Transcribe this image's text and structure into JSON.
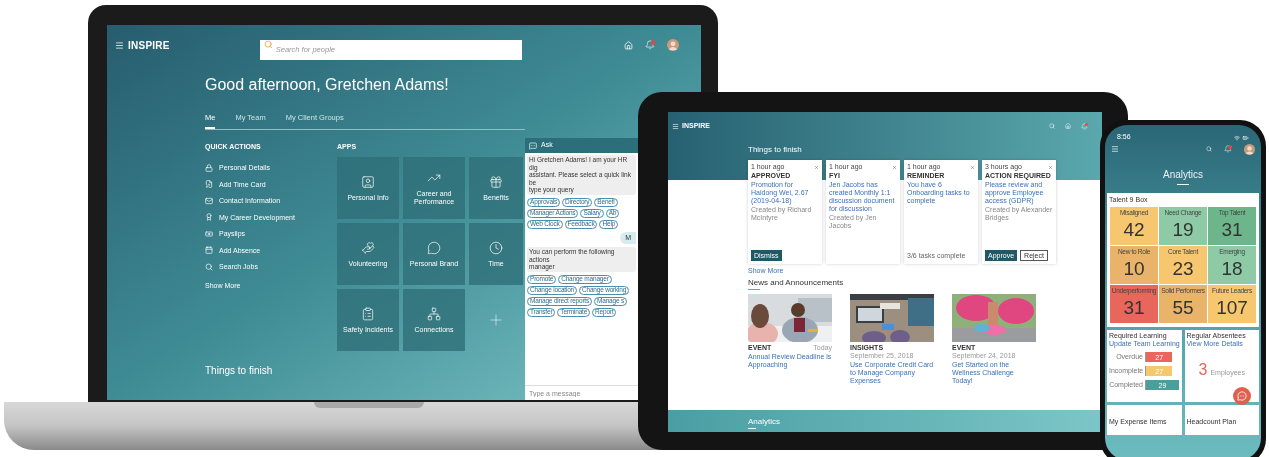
{
  "laptop": {
    "app_name": "INSPIRE",
    "search": {
      "placeholder": "Search for people"
    },
    "greeting": "Good afternoon, Gretchen Adams!",
    "tabs": [
      {
        "label": "Me",
        "selected": true
      },
      {
        "label": "My Team",
        "selected": false
      },
      {
        "label": "My Client Groups",
        "selected": false
      }
    ],
    "quick_actions": {
      "heading": "QUICK ACTIONS",
      "items": [
        "Personal Details",
        "Add Time Card",
        "Contact Information",
        "My Career Development",
        "Payslips",
        "Add Absence",
        "Search Jobs"
      ],
      "show_more": "Show More"
    },
    "apps": {
      "heading": "APPS",
      "tiles": [
        {
          "kind": "app",
          "label": "Personal Info"
        },
        {
          "kind": "app",
          "label": "Career and Performance"
        },
        {
          "kind": "app",
          "label": "Benefits"
        },
        {
          "kind": "app",
          "label": "Volunteering"
        },
        {
          "kind": "app",
          "label": "Personal Brand"
        },
        {
          "kind": "app",
          "label": "Time"
        },
        {
          "kind": "app",
          "label": "Safety Incidents"
        },
        {
          "kind": "app",
          "label": "Connections"
        },
        {
          "kind": "add"
        }
      ]
    },
    "section_title": "Things to finish",
    "chat": {
      "title": "Ask",
      "messages": [
        {
          "kind": "bot",
          "lines": [
            "Hi Gretchen Adams! I am your HR dig",
            "assistant. Please select a quick link be",
            "type your query"
          ]
        },
        {
          "kind": "chips",
          "rows": [
            [
              "Approvals",
              "Directory",
              "Benefi"
            ],
            [
              "Manager Actions",
              "Salary",
              "Ab"
            ],
            [
              "Web Clock",
              "Feedback",
              "Help"
            ]
          ]
        },
        {
          "kind": "user",
          "text": "M"
        },
        {
          "kind": "bot",
          "lines": [
            "You can perform the following actions",
            "manager"
          ]
        },
        {
          "kind": "chips",
          "rows": [
            [
              "Promote",
              "Change manager"
            ],
            [
              "Change location",
              "Change working"
            ],
            [
              "Manage direct reports",
              "Manage s"
            ],
            [
              "Transfer",
              "Terminate",
              "Report"
            ]
          ]
        }
      ],
      "input": {
        "placeholder": "Type a message"
      }
    }
  },
  "tablet": {
    "app_name": "INSPIRE",
    "section_title": "Things to finish",
    "cards": [
      {
        "time": "1 hour ago",
        "tag": "APPROVED",
        "title": "Promotion for Haidong Wei, 2.67 (2019-04-18)",
        "creator": "Created by Richard McIntyre",
        "buttons": [
          {
            "label": "Dismiss",
            "kind": "primary"
          }
        ]
      },
      {
        "time": "1 hour ago",
        "tag": "FYI",
        "title": "Jen Jacobs has created Monthly 1:1 discussion document for discussion",
        "creator": "Created by Jen Jacobs"
      },
      {
        "time": "1 hour ago",
        "tag": "REMINDER",
        "title": "You have 6 Onboarding tasks to complete",
        "progress": "3/6 tasks complete"
      },
      {
        "time": "3 hours ago",
        "tag": "ACTION REQUIRED",
        "title": "Please review and approve Employee access (GDPR)",
        "creator": "Created by Alexander Bridges",
        "buttons": [
          {
            "label": "Approve",
            "kind": "primary"
          },
          {
            "label": "Reject",
            "kind": "secondary"
          }
        ]
      }
    ],
    "show_more": "Show More",
    "news_title": "News and Announcements",
    "news": [
      {
        "tag": "EVENT",
        "date": "Today",
        "title": "Annual Review Deadline is Approaching",
        "kind": "picture"
      },
      {
        "tag": "INSIGHTS",
        "date": "September 25, 2018",
        "title": "Use Corporate Credit Card to Manage Company Expenses",
        "kind": "picture"
      },
      {
        "tag": "EVENT",
        "date": "September 24, 2018",
        "title": "Get Started on the Wellness Challenge Today!",
        "kind": "picture"
      }
    ],
    "footer_title": "Analytics"
  },
  "phone": {
    "time": "8:56",
    "title": "Analytics",
    "talent_box": {
      "title": "Talent 9 Box",
      "cells": [
        {
          "label": "Misaligned",
          "value": "42",
          "color": "#f6c76f"
        },
        {
          "label": "Need Change",
          "value": "19",
          "color": "#8ecaa5"
        },
        {
          "label": "Top Talent",
          "value": "31",
          "color": "#6db68b"
        },
        {
          "label": "New to Role",
          "value": "10",
          "color": "#eab36a"
        },
        {
          "label": "Core Talent",
          "value": "23",
          "color": "#f6c76f"
        },
        {
          "label": "Emerging",
          "value": "18",
          "color": "#8ecaa5"
        },
        {
          "label": "Underperforming",
          "value": "31",
          "color": "#e8665b"
        },
        {
          "label": "Solid Performers",
          "value": "55",
          "color": "#eab36a"
        },
        {
          "label": "Future Leaders",
          "value": "107",
          "color": "#f6c76f"
        }
      ]
    },
    "learning": {
      "title": "Required Learning",
      "link": "Update Team Learning",
      "bars": [
        {
          "label": "Overdue",
          "value": "27",
          "level": 0.8,
          "color": "#e8665b"
        },
        {
          "label": "Incomplete",
          "value": "27",
          "level": 0.8,
          "color": "#f4c96d"
        },
        {
          "label": "Completed",
          "value": "29",
          "level": 1,
          "color": "#4b9e9c"
        }
      ]
    },
    "absentees": {
      "title": "Regular Absentees",
      "link": "View More Details",
      "count": "3",
      "unit": "Employees"
    },
    "more_cards": [
      "My Expense Items",
      "Headcount Plan"
    ]
  }
}
